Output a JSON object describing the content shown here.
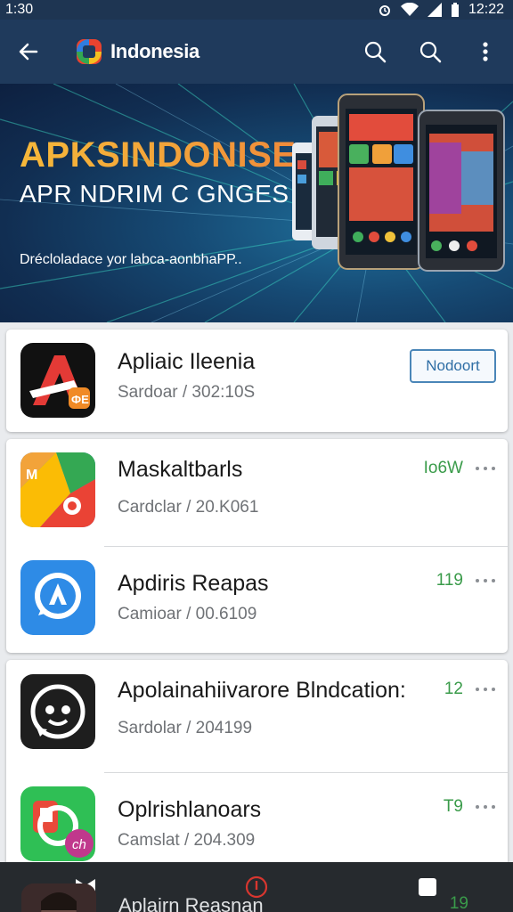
{
  "status_bar": {
    "time_left": "1:30",
    "time_right": "12:22"
  },
  "app_bar": {
    "title": "Indonesia",
    "icons": [
      "back-arrow-icon",
      "search-icon",
      "search-icon",
      "more-vert-icon"
    ]
  },
  "banner": {
    "title": "APKSINDONISE",
    "subtitle": "APR NDRIM C GNGES",
    "tagline": "Drécloladace yor labca-aonbhaPP.."
  },
  "apps": [
    {
      "name": "Apliaic Ileenia",
      "meta": "Sardoar / 302:10S",
      "action_label": "Nodoort",
      "icon": "red-a-app-icon"
    },
    {
      "name": "Maskaltbarls",
      "meta": "Cardclar / 20.K061",
      "rating": "Io6W",
      "icon": "maps-colorful-icon"
    },
    {
      "name": "Apdiris Reapas",
      "meta": "Camioar / 00.6109",
      "rating": "119",
      "icon": "blue-chat-a-icon"
    },
    {
      "name": "Apolainahiivarore Blndcation:",
      "meta": "Sardolar / 204199",
      "rating": "12",
      "icon": "black-smile-chat-icon"
    },
    {
      "name": "Oplrishlanoars",
      "meta": "Camslat / 204.309",
      "rating": "T9",
      "icon": "green-chat-icon"
    }
  ],
  "peek_item": {
    "name": "Aplairn Reasnan",
    "rating": "19"
  },
  "bottom_nav": [
    "bowtie-icon",
    "alert-circle-icon",
    "square-icon"
  ],
  "colors": {
    "app_bar": "#1f3a5c",
    "accent_green": "#3a9b4a",
    "button_blue": "#2f6ea5"
  }
}
